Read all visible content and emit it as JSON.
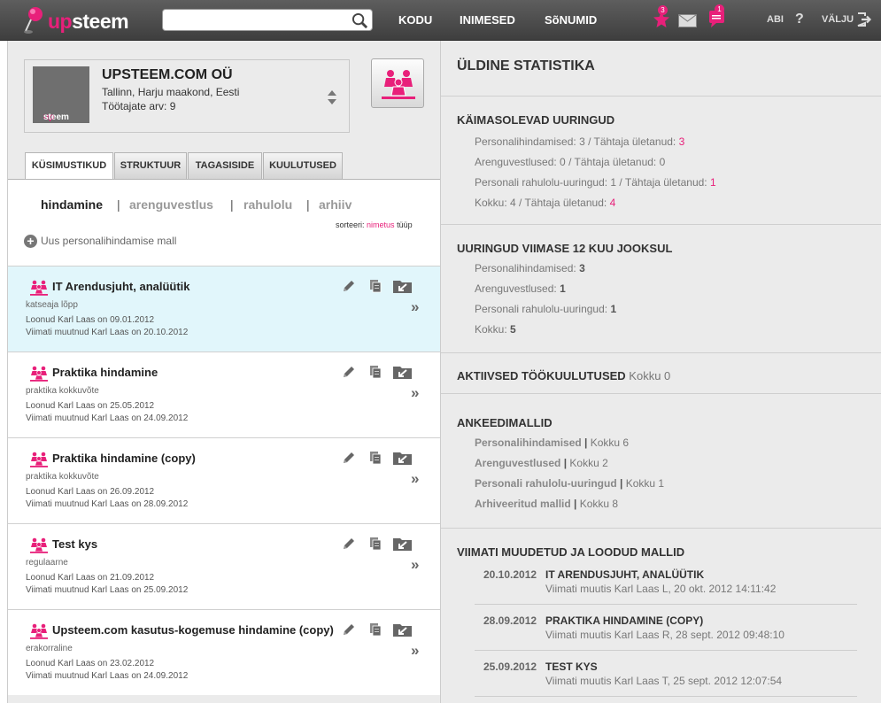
{
  "brand": {
    "part1": "up",
    "part2": "steem"
  },
  "search": {
    "placeholder": ""
  },
  "nav": {
    "home": "KODU",
    "people": "INIMESED",
    "messages": "SõNUMID"
  },
  "notifications": {
    "star_count": "3",
    "chat_count": "1"
  },
  "links": {
    "help": "ABI",
    "help_symbol": "?",
    "logout": "VÄLJU"
  },
  "company": {
    "name": "UPSTEEM.COM OÜ",
    "address": "Tallinn, Harju maakond, Eesti",
    "employees": "Töötajate arv: 9",
    "logo_text_up": "up",
    "logo_text_steem": "steem"
  },
  "tabs": [
    {
      "label": "KÜSIMUSTIKUD"
    },
    {
      "label": "STRUKTUUR"
    },
    {
      "label": "TAGASISIDE"
    },
    {
      "label": "KUULUTUSED"
    }
  ],
  "subtabs": [
    {
      "label": "hindamine"
    },
    {
      "label": "arenguvestlus"
    },
    {
      "label": "rahulolu"
    },
    {
      "label": "arhiiv"
    }
  ],
  "subtab_separator": "|",
  "sort": {
    "label": "sorteeri:",
    "name": "nimetus",
    "type": "tüüp"
  },
  "new_template": {
    "plus": "+",
    "label": "Uus personalihindamise mall"
  },
  "chevron": "»",
  "templates": [
    {
      "title": "IT Arendusjuht, analüütik",
      "type": "katseaja lõpp",
      "created": "Loonud Karl Laas on 09.01.2012",
      "modified": "Viimati muutnud Karl Laas on 20.10.2012"
    },
    {
      "title": "Praktika hindamine",
      "type": "praktika kokkuvõte",
      "created": "Loonud Karl Laas on 25.05.2012",
      "modified": "Viimati muutnud Karl Laas on 24.09.2012"
    },
    {
      "title": "Praktika hindamine (copy)",
      "type": "praktika kokkuvõte",
      "created": "Loonud Karl Laas on 26.09.2012",
      "modified": "Viimati muutnud Karl Laas on 28.09.2012"
    },
    {
      "title": "Test kys",
      "type": "regulaarne",
      "created": "Loonud Karl Laas on 21.09.2012",
      "modified": "Viimati muutnud Karl Laas on 25.09.2012"
    },
    {
      "title": "Upsteem.com kasutus-kogemuse hindamine (copy)",
      "type": "erakorraline",
      "created": "Loonud Karl Laas on 23.02.2012",
      "modified": "Viimati muutnud Karl Laas on 24.09.2012"
    }
  ],
  "stats": {
    "title": "ÜLDINE STATISTIKA",
    "ongoing": {
      "title": "KÄIMASOLEVAD UURINGUD",
      "rows": [
        {
          "label": "Personalihindamised: 3 / Tähtaja ületanud: ",
          "value": "3"
        },
        {
          "label": "Arenguvestlused: 0 / Tähtaja ületanud: ",
          "value": "0"
        },
        {
          "label": "Personali rahulolu-uuringud: 1 / Tähtaja ületanud: ",
          "value": "1"
        },
        {
          "label": "Kokku: 4 / Tähtaja ületanud: ",
          "value": "4"
        }
      ]
    },
    "last12": {
      "title": "UURINGUD VIIMASE 12 KUU JOOKSUL",
      "rows": [
        {
          "label": "Personalihindamised: ",
          "value": "3"
        },
        {
          "label": "Arenguvestlused: ",
          "value": "1"
        },
        {
          "label": "Personali rahulolu-uuringud: ",
          "value": "1"
        },
        {
          "label": "Kokku: ",
          "value": "5"
        }
      ]
    },
    "ads": {
      "title": "AKTIIVSED TÖÖKUULUTUSED",
      "suffix": "Kokku 0"
    },
    "templates": {
      "title": "ANKEEDIMALLID",
      "rows": [
        {
          "label": "Personalihindamised",
          "sep": "|",
          "value": "Kokku 6"
        },
        {
          "label": "Arenguvestlused",
          "sep": "|",
          "value": "Kokku 2"
        },
        {
          "label": "Personali rahulolu-uuringud",
          "sep": "|",
          "value": "Kokku 1"
        },
        {
          "label": "Arhiveeritud mallid",
          "sep": "|",
          "value": "Kokku 8"
        }
      ]
    },
    "recent": {
      "title": "VIIMATI MUUDETUD JA LOODUD MALLID",
      "rows": [
        {
          "date": "20.10.2012",
          "name": "IT ARENDUSJUHT, ANALÜÜTIK",
          "sub": "Viimati muutis Karl Laas L, 20 okt. 2012 14:11:42"
        },
        {
          "date": "28.09.2012",
          "name": "PRAKTIKA HINDAMINE (COPY)",
          "sub": "Viimati muutis Karl Laas R, 28 sept. 2012 09:48:10"
        },
        {
          "date": "25.09.2012",
          "name": "TEST KYS",
          "sub": "Viimati muutis Karl Laas T, 25 sept. 2012 12:07:54"
        }
      ]
    }
  }
}
